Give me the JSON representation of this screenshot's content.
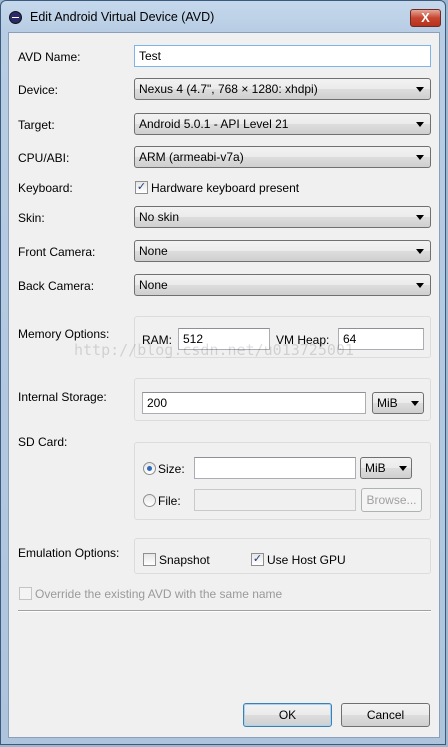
{
  "window": {
    "title": "Edit Android Virtual Device (AVD)",
    "close_glyph": "X"
  },
  "form": {
    "avd_name": {
      "label": "AVD Name:",
      "value": "Test"
    },
    "device": {
      "label": "Device:",
      "value": "Nexus 4 (4.7\", 768 × 1280: xhdpi)"
    },
    "target": {
      "label": "Target:",
      "value": "Android 5.0.1 - API Level 21"
    },
    "cpu_abi": {
      "label": "CPU/ABI:",
      "value": "ARM (armeabi-v7a)"
    },
    "keyboard": {
      "label": "Keyboard:",
      "checkbox_label": "Hardware keyboard present",
      "checked": true
    },
    "skin": {
      "label": "Skin:",
      "value": "No skin"
    },
    "front_camera": {
      "label": "Front Camera:",
      "value": "None"
    },
    "back_camera": {
      "label": "Back Camera:",
      "value": "None"
    },
    "memory": {
      "label": "Memory Options:",
      "ram_label": "RAM:",
      "ram_value": "512",
      "vm_heap_label": "VM Heap:",
      "vm_heap_value": "64"
    },
    "internal_storage": {
      "label": "Internal Storage:",
      "value": "200",
      "unit": "MiB"
    },
    "sd_card": {
      "label": "SD Card:",
      "size_label": "Size:",
      "size_value": "",
      "size_unit": "MiB",
      "size_selected": true,
      "file_label": "File:",
      "file_value": "",
      "browse_label": "Browse..."
    },
    "emulation": {
      "label": "Emulation Options:",
      "snapshot_label": "Snapshot",
      "snapshot_checked": false,
      "host_gpu_label": "Use Host GPU",
      "host_gpu_checked": true
    },
    "override": {
      "label": "Override the existing AVD with the same name",
      "checked": false
    }
  },
  "buttons": {
    "ok": "OK",
    "cancel": "Cancel"
  },
  "check_glyph": "✓",
  "watermark": "http://blog.csdn.net/u013725001",
  "colors": {
    "title_close": "#c7452f",
    "radio_dot": "#2d6ab8",
    "default_button_border": "#3c7fb1"
  }
}
